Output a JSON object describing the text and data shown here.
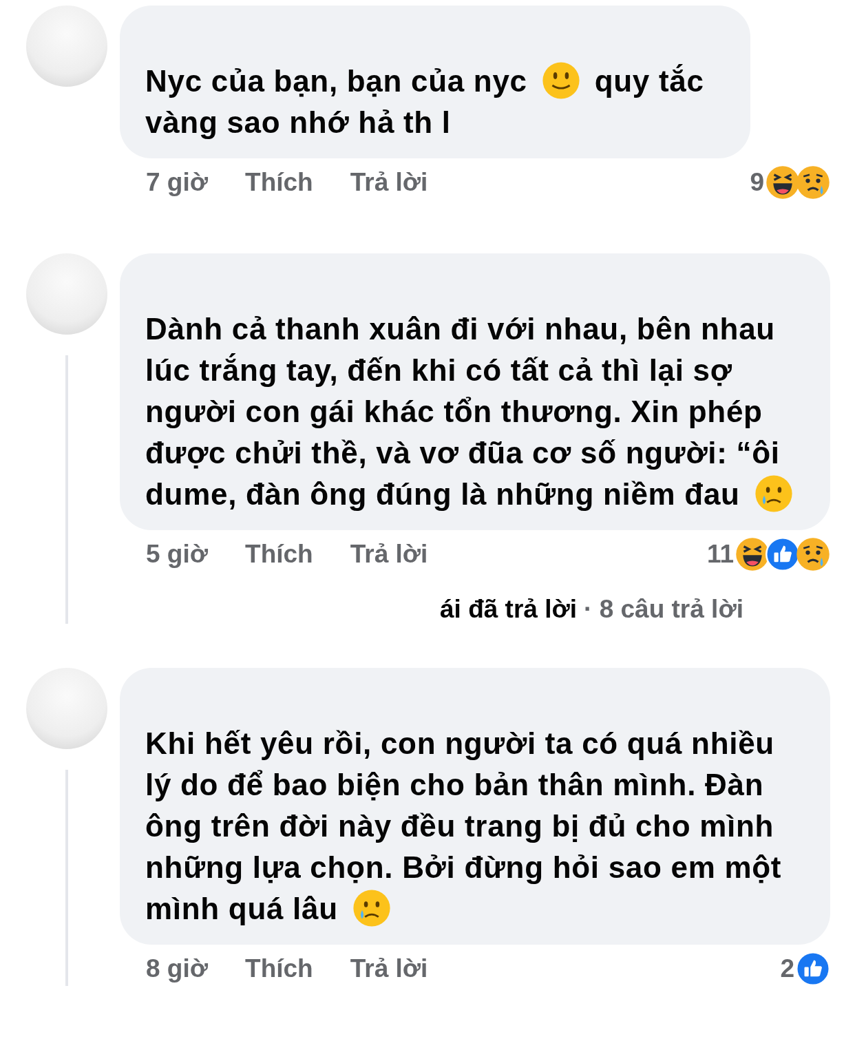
{
  "comments": [
    {
      "body": [
        {
          "kind": "text",
          "text": "Nyc của bạn, bạn của nyc"
        },
        {
          "kind": "smile"
        },
        {
          "kind": "text",
          "text": "quy tắc vàng sao"
        },
        {
          "kind": "text",
          "text": "nhớ hả th l"
        }
      ],
      "time": "7 giờ",
      "like": "Thích",
      "reply": "Trả lời",
      "reaction_count": "9",
      "reactions": [
        {
          "kind": "haha"
        },
        {
          "kind": "sad"
        }
      ]
    },
    {
      "thread_line": true,
      "body": [
        {
          "kind": "text",
          "text": "Dành cả thanh xuân đi với nhau, bên nhau lúc trắng tay, đến khi có tất cả thì lại sợ người con gái khác tổn thương. Xin phép được chửi thề, và vơ đũa cơ số người: “ôi dume, đàn ông đúng là những niềm đau"
        },
        {
          "kind": "tear"
        }
      ],
      "time": "5 giờ",
      "like": "Thích",
      "reply": "Trả lời",
      "reaction_count": "11",
      "reactions": [
        {
          "kind": "haha"
        },
        {
          "kind": "like"
        },
        {
          "kind": "sad"
        }
      ],
      "replies_summary": {
        "action": "ái đã trả lời",
        "count": "· 8 câu trả lời"
      }
    },
    {
      "thread_line": true,
      "body": [
        {
          "kind": "text",
          "text": "Khi hết yêu rồi, con người ta có quá nhiều lý do để bao biện cho bản thân mình. Đàn ông trên đời này đều trang bị đủ cho mình những lựa chọn. Bởi đừng hỏi sao em một mình quá lâu"
        },
        {
          "kind": "tear"
        }
      ],
      "time": "8 giờ",
      "like": "Thích",
      "reply": "Trả lời",
      "reaction_count": "2",
      "reactions": [
        {
          "kind": "like"
        }
      ]
    }
  ]
}
